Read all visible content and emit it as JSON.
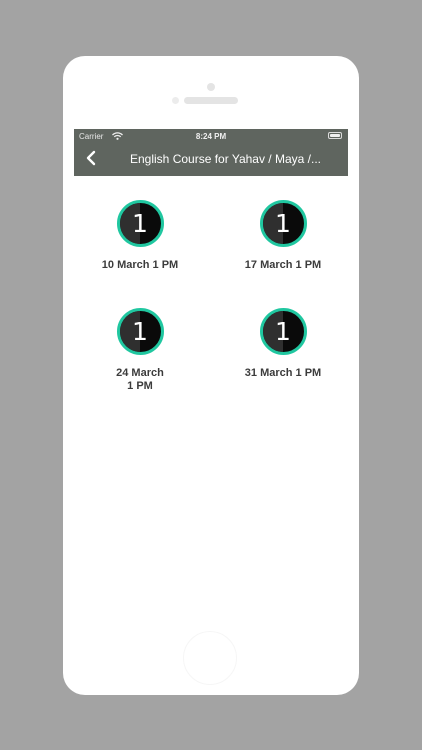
{
  "status_bar": {
    "carrier": "Carrier",
    "time": "8:24 PM"
  },
  "navbar": {
    "title": "English Course for Yahav / Maya /..."
  },
  "sessions": [
    {
      "number": "1",
      "label": "10 March 1 PM"
    },
    {
      "number": "1",
      "label": "17 March 1 PM"
    },
    {
      "number": "1",
      "label_line1": "24 March",
      "label_line2": "1 PM"
    },
    {
      "number": "1",
      "label": "31 March 1 PM"
    }
  ],
  "colors": {
    "background": "#a3a3a3",
    "navbar": "#5f655f",
    "accent_ring": "#20c7a0",
    "badge_dark": "#0a0a0a",
    "label_text": "#3c3c3c"
  },
  "icons": {
    "back": "chevron-left-icon",
    "wifi": "wifi-icon",
    "battery": "battery-icon"
  }
}
